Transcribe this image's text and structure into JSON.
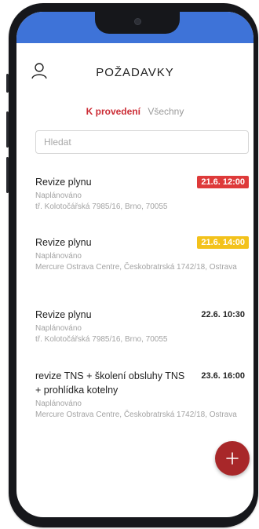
{
  "header": {
    "title": "POŽADAVKY",
    "user_icon": "user-icon"
  },
  "tabs": [
    {
      "label": "K provedení",
      "active": true
    },
    {
      "label": "Všechny",
      "active": false
    }
  ],
  "search": {
    "placeholder": "Hledat",
    "value": ""
  },
  "requests": [
    {
      "title": "Revize plynu",
      "status": "Naplánováno",
      "address": "tř. Kolotočářská 7985/16, Brno, 70055",
      "date": "21.6. 12:00",
      "badge_color": "#de3a3a"
    },
    {
      "title": "Revize plynu",
      "status": "Naplánováno",
      "address": "Mercure Ostrava Centre, Českobratrská 1742/18, Ostrava",
      "date": "21.6. 14:00",
      "badge_color": "#f3c21b"
    },
    {
      "title": "Revize plynu",
      "status": "Naplánováno",
      "address": "tř. Kolotočářská 7985/16, Brno, 70055",
      "date": "22.6. 10:30",
      "badge_color": ""
    },
    {
      "title": "revize TNS + školení obsluhy TNS + prohlídka kotelny",
      "status": "Naplánováno",
      "address": "Mercure Ostrava Centre, Českobratrská 1742/18, Ostrava",
      "date": "23.6. 16:00",
      "badge_color": ""
    }
  ],
  "fab": {
    "icon": "plus-icon",
    "color": "#a82729"
  },
  "colors": {
    "status_bar": "#3e73d8",
    "accent": "#cc2d36"
  }
}
